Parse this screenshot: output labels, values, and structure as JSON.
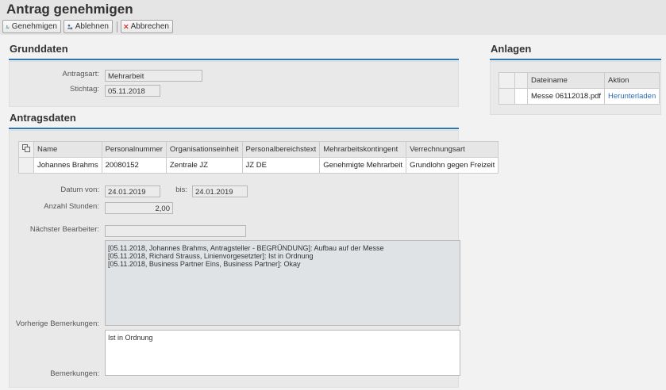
{
  "page": {
    "title": "Antrag genehmigen"
  },
  "toolbar": {
    "approve_label": "Genehmigen",
    "reject_label": "Ablehnen",
    "cancel_label": "Abbrechen"
  },
  "grunddaten": {
    "title": "Grunddaten",
    "antragsart_label": "Antragsart:",
    "antragsart_value": "Mehrarbeit",
    "stichtag_label": "Stichtag:",
    "stichtag_value": "05.11.2018"
  },
  "anlagen": {
    "title": "Anlagen",
    "columns": [
      "Dateiname",
      "Aktion"
    ],
    "rows": [
      {
        "filename": "Messe 06112018.pdf",
        "action": "Herunterladen"
      }
    ]
  },
  "antragsdaten": {
    "title": "Antragsdaten",
    "columns": [
      "Name",
      "Personalnummer",
      "Organisationseinheit",
      "Personalbereichstext",
      "Mehrarbeitskontingent",
      "Verrechnungsart"
    ],
    "rows": [
      {
        "name": "Johannes Brahms",
        "personalnummer": "20080152",
        "orgeinheit": "Zentrale JZ",
        "personalbereich": "JZ DE",
        "kontingent": "Genehmigte Mehrarbeit",
        "verrechnung": "Grundlohn gegen Freizeit"
      }
    ],
    "datum_von_label": "Datum von:",
    "datum_von_value": "24.01.2019",
    "bis_label": "bis:",
    "bis_value": "24.01.2019",
    "anzahl_label": "Anzahl Stunden:",
    "anzahl_value": "2,00",
    "bearbeiter_label": "Nächster Bearbeiter:",
    "bearbeiter_value": "",
    "vorherige_label": "Vorherige Bemerkungen:",
    "vorherige_lines": [
      "[05.11.2018, Johannes Brahms, Antragsteller - BEGRÜNDUNG]: Aufbau auf der Messe",
      "[05.11.2018, Richard Strauss, Linienvorgesetzter]: Ist in Ordnung",
      "[05.11.2018, Business Partner Eins, Business Partner]: Okay"
    ],
    "bemerkungen_label": "Bemerkungen:",
    "bemerkungen_value": "Ist in Ordnung"
  },
  "colors": {
    "accent": "#2e75b6",
    "link": "#2b6cb5",
    "cancel_icon": "#d9302c"
  },
  "icons": {
    "approve": "approve-person-icon",
    "reject": "reject-person-icon",
    "cancel": "cancel-x-icon",
    "table_settings": "table-settings-icon"
  }
}
